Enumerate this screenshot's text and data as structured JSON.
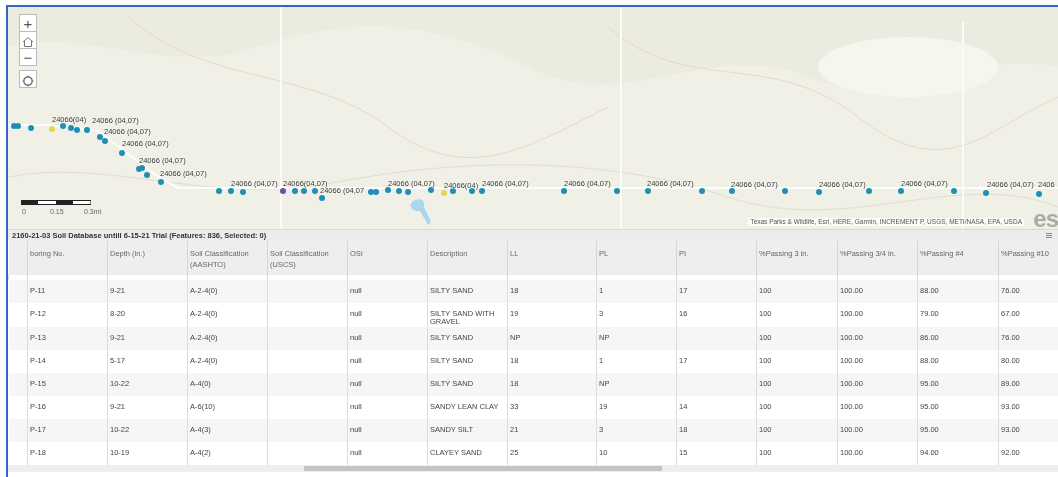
{
  "map": {
    "kind": "picture",
    "zoom_controls": [
      "+",
      "−"
    ],
    "labels": [
      "24066(04)",
      "24066 (04,07)",
      "24066 (04,07)",
      "24066 (04,07)",
      "24066 (04,07)",
      "24066 (04,07)",
      "24066 (04,07)",
      "24066(04,07)",
      "24066 (04,07",
      "24066 (04,07)",
      "24066(04)",
      "24066 (04,07)",
      "24066 (04,07)",
      "24066 (04,07)",
      "24066 (04,07)",
      "24066 (04,07)",
      "24066 (04,07)",
      "24066 (04,07)",
      "2406"
    ],
    "markers": [
      {
        "color": "#1f8fb5"
      },
      {
        "color": "#1f8fb5"
      },
      {
        "color": "#1f8fb5"
      },
      {
        "color": "#e8d44d"
      },
      {
        "color": "#1f8fb5"
      },
      {
        "color": "#1f8fb5"
      },
      {
        "color": "#1f8fb5"
      },
      {
        "color": "#1f8fb5"
      },
      {
        "color": "#1f8fb5"
      },
      {
        "color": "#1f8fb5"
      },
      {
        "color": "#1f8fb5"
      },
      {
        "color": "#1f8fb5"
      },
      {
        "color": "#1f8fb5"
      },
      {
        "color": "#1f8fb5"
      },
      {
        "color": "#1f8fb5"
      },
      {
        "color": "#1f8fb5"
      },
      {
        "color": "#1f8fb5"
      },
      {
        "color": "#1f8fb5"
      },
      {
        "color": "#6b4fa8"
      },
      {
        "color": "#1f8fb5"
      },
      {
        "color": "#1f8fb5"
      },
      {
        "color": "#1f8fb5"
      },
      {
        "color": "#1f8fb5"
      },
      {
        "color": "#1f8fb5"
      },
      {
        "color": "#1f8fb5"
      },
      {
        "color": "#1f8fb5"
      },
      {
        "color": "#1f8fb5"
      },
      {
        "color": "#1f8fb5"
      },
      {
        "color": "#1f8fb5"
      },
      {
        "color": "#e8d44d"
      },
      {
        "color": "#1f8fb5"
      },
      {
        "color": "#1f8fb5"
      },
      {
        "color": "#1f8fb5"
      },
      {
        "color": "#1f8fb5"
      },
      {
        "color": "#1f8fb5"
      },
      {
        "color": "#1f8fb5"
      },
      {
        "color": "#1f8fb5"
      },
      {
        "color": "#1f8fb5"
      },
      {
        "color": "#1f8fb5"
      },
      {
        "color": "#1f8fb5"
      },
      {
        "color": "#1f8fb5"
      },
      {
        "color": "#1f8fb5"
      },
      {
        "color": "#1f8fb5"
      },
      {
        "color": "#1f8fb5"
      },
      {
        "color": "#1f8fb5"
      }
    ],
    "scale_labels": [
      "0",
      "0.15",
      "0.3mi"
    ],
    "attribution": "Texas Parks & Wildlife, Esri, HERE, Garmin, INCREMENT P, USGS, METI/NASA, EPA, USDA",
    "logo_text": "es"
  },
  "table": {
    "title": "2160-21-03 Soil Database untill 6-15-21 Trial (Features: 836, Selected: 0)",
    "columns": [
      "boring No.",
      "Depth (in.)",
      "Soil Classification (AASHTO)",
      "Soil Classification (USCS)",
      "OSI",
      "Description",
      "LL",
      "PL",
      "PI",
      "%Passing 3 in.",
      "%Passing 3/4 in.",
      "%Passing #4",
      "%Passing #10"
    ],
    "rows": [
      [
        "P-11",
        "9-21",
        "A-2-4(0)",
        "",
        "null",
        "SILTY SAND",
        "18",
        "1",
        "17",
        "100",
        "100.00",
        "88.00",
        "76.00"
      ],
      [
        "P-12",
        "8-20",
        "A-2-4(0)",
        "",
        "null",
        "SILTY SAND WITH GRAVEL",
        "19",
        "3",
        "16",
        "100",
        "100.00",
        "79.00",
        "67.00"
      ],
      [
        "P-13",
        "9-21",
        "A-2-4(0)",
        "",
        "null",
        "SILTY SAND",
        "NP",
        "NP",
        "",
        "100",
        "100.00",
        "86.00",
        "76.00"
      ],
      [
        "P-14",
        "5-17",
        "A-2-4(0)",
        "",
        "null",
        "SILTY SAND",
        "18",
        "1",
        "17",
        "100",
        "100.00",
        "88.00",
        "80.00"
      ],
      [
        "P-15",
        "10-22",
        "A-4(0)",
        "",
        "null",
        "SILTY SAND",
        "18",
        "NP",
        "",
        "100",
        "100.00",
        "95.00",
        "89.00"
      ],
      [
        "P-16",
        "9-21",
        "A-6(10)",
        "",
        "null",
        "SANDY LEAN CLAY",
        "33",
        "19",
        "14",
        "100",
        "100.00",
        "95.00",
        "93.00"
      ],
      [
        "P-17",
        "10-22",
        "A-4(3)",
        "",
        "null",
        "SANDY SILT",
        "21",
        "3",
        "18",
        "100",
        "100.00",
        "95.00",
        "93.00"
      ],
      [
        "P-18",
        "10-19",
        "A-4(2)",
        "",
        "null",
        "CLAYEY SAND",
        "25",
        "10",
        "15",
        "100",
        "100.00",
        "94.00",
        "92.00"
      ]
    ]
  }
}
